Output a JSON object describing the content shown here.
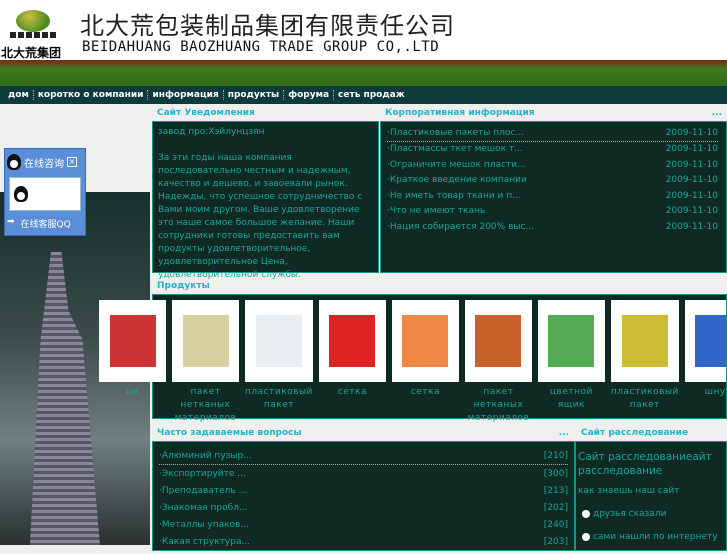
{
  "header": {
    "logo_text": "北大荒集团",
    "title_cn": "北大荒包装制品集团有限责任公司",
    "title_en": "BEIDAHUANG BAOZHUANG TRADE GROUP CO,.LTD"
  },
  "nav": [
    "дом",
    "коротко о компании",
    "информация",
    "продукты",
    "форума",
    "сеть продаж"
  ],
  "qq": {
    "title": "在线咨询",
    "service": "在线客服QQ"
  },
  "notice": {
    "title": "Сайт Уведомления",
    "line1": "завод  про:Хэйлунцзян",
    "body": "За эти годы наша компания последовательно честным и надежным, качество и дешево, и завоевали рынок. Надежды, что успешное сотрудничество с Вами моим другом. Ваше удовлетворение это наше самое большое желание. Наши сотрудники готовы предоставить вам продукты удовлетворительное, удовлетворительное Цена, удовлетворительной службы."
  },
  "corp": {
    "title": "Корпоративная информация",
    "more": "...",
    "items": [
      {
        "t": "·Пластиковые пакеты плос...",
        "d": "2009-11-10"
      },
      {
        "t": "·Пластмассы ткет мешок т...",
        "d": "2009-11-10"
      },
      {
        "t": "·Ограничите мешок пласти...",
        "d": "2009-11-10"
      },
      {
        "t": "·Краткое введение компании",
        "d": "2009-11-10"
      },
      {
        "t": "·Не иметь товар ткани и п...",
        "d": "2009-11-10"
      },
      {
        "t": "·Что не имеют ткань",
        "d": "2009-11-10"
      },
      {
        "t": "·Нация собирается 200% выс...",
        "d": "2009-11-10"
      }
    ]
  },
  "products": {
    "title": "Продукты",
    "items": [
      {
        "name": "ци",
        "color": "#c33"
      },
      {
        "name": "пакет нетканых материалов",
        "color": "#d8d0a0"
      },
      {
        "name": "пластиковый пакет",
        "color": "#e8eef0"
      },
      {
        "name": "сетка",
        "color": "#d22"
      },
      {
        "name": "сетка",
        "color": "#e84"
      },
      {
        "name": "пакет нетканых материалов",
        "color": "#c8622a"
      },
      {
        "name": "цветной ящик",
        "color": "#5a5"
      },
      {
        "name": "пластиковый пакет",
        "color": "#cb3"
      },
      {
        "name": "шнур",
        "color": "#36c"
      }
    ]
  },
  "faq": {
    "title": "Часто задаваемые вопросы",
    "more": "...",
    "items": [
      {
        "t": "·Алюминий пузыр...",
        "n": "[210]"
      },
      {
        "t": "·Экспортируйте ...",
        "n": "[300]"
      },
      {
        "t": "·Преподаватель ...",
        "n": "[213]"
      },
      {
        "t": "·Знакомая пробл...",
        "n": "[202]"
      },
      {
        "t": "·Металлы упаков...",
        "n": "[240]"
      },
      {
        "t": "·Какая структура...",
        "n": "[203]"
      }
    ]
  },
  "survey": {
    "title": "Сайт расследование",
    "heading": "Сайт расследованиеайт расследование",
    "question": "как знаешь наш сайт",
    "options": [
      "друзья сказали",
      "сами нашли по интернету"
    ]
  }
}
